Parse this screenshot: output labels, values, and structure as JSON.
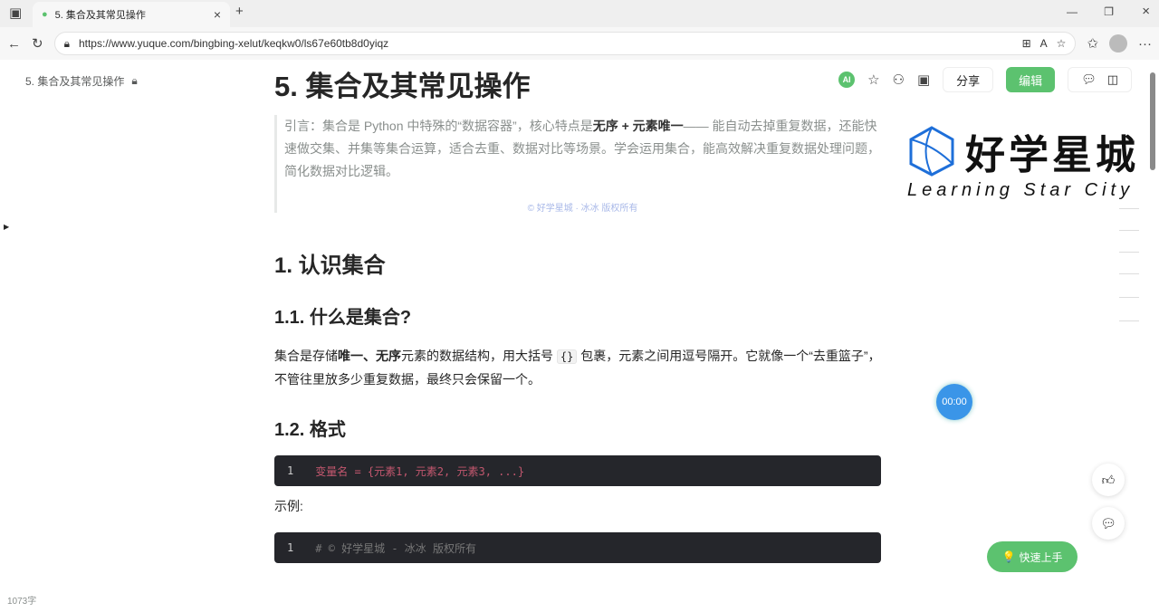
{
  "browser": {
    "tab_title": "5. 集合及其常见操作",
    "url": "https://www.yuque.com/bingbing-xelut/keqkw0/ls67e60tb8d0yiqz"
  },
  "docbar": {
    "title": "5. 集合及其常见操作",
    "ai": "AI",
    "share": "分享",
    "edit": "编辑"
  },
  "logo": {
    "cn": "好学星城",
    "en": "Learning Star City"
  },
  "doc": {
    "title": "5. 集合及其常见操作",
    "quote_pre": "引言：集合是 Python 中特殊的“数据容器”，核心特点是",
    "quote_bold": "无序 + 元素唯一",
    "quote_post": "—— 能自动去掉重复数据，还能快速做交集、并集等集合运算，适合去重、数据对比等场景。学会运用集合，能高效解决重复数据处理问题，简化数据对比逻辑。",
    "copyright": "© 好学星城 · 冰冰 版权所有",
    "h2_1": "1. 认识集合",
    "h3_1": "1.1. 什么是集合?",
    "p1_a": "集合是存储",
    "p1_b": "唯一、无序",
    "p1_c": "元素的数据结构，用大括号",
    "p1_code": "{}",
    "p1_d": "包裹，元素之间用逗号隔开。它就像一个“去重篮子”，不管往里放多少重复数据，最终只会保留一个。",
    "h3_2": "1.2. 格式",
    "code1_ln": "1",
    "code1": "变量名 = {元素1, 元素2, 元素3, ...}",
    "example": "示例:",
    "code2_ln": "1",
    "code2": "# © 好学星城 - 冰冰 版权所有"
  },
  "widgets": {
    "timer": "00:00",
    "quick": "快速上手",
    "word_count": "1073字"
  }
}
